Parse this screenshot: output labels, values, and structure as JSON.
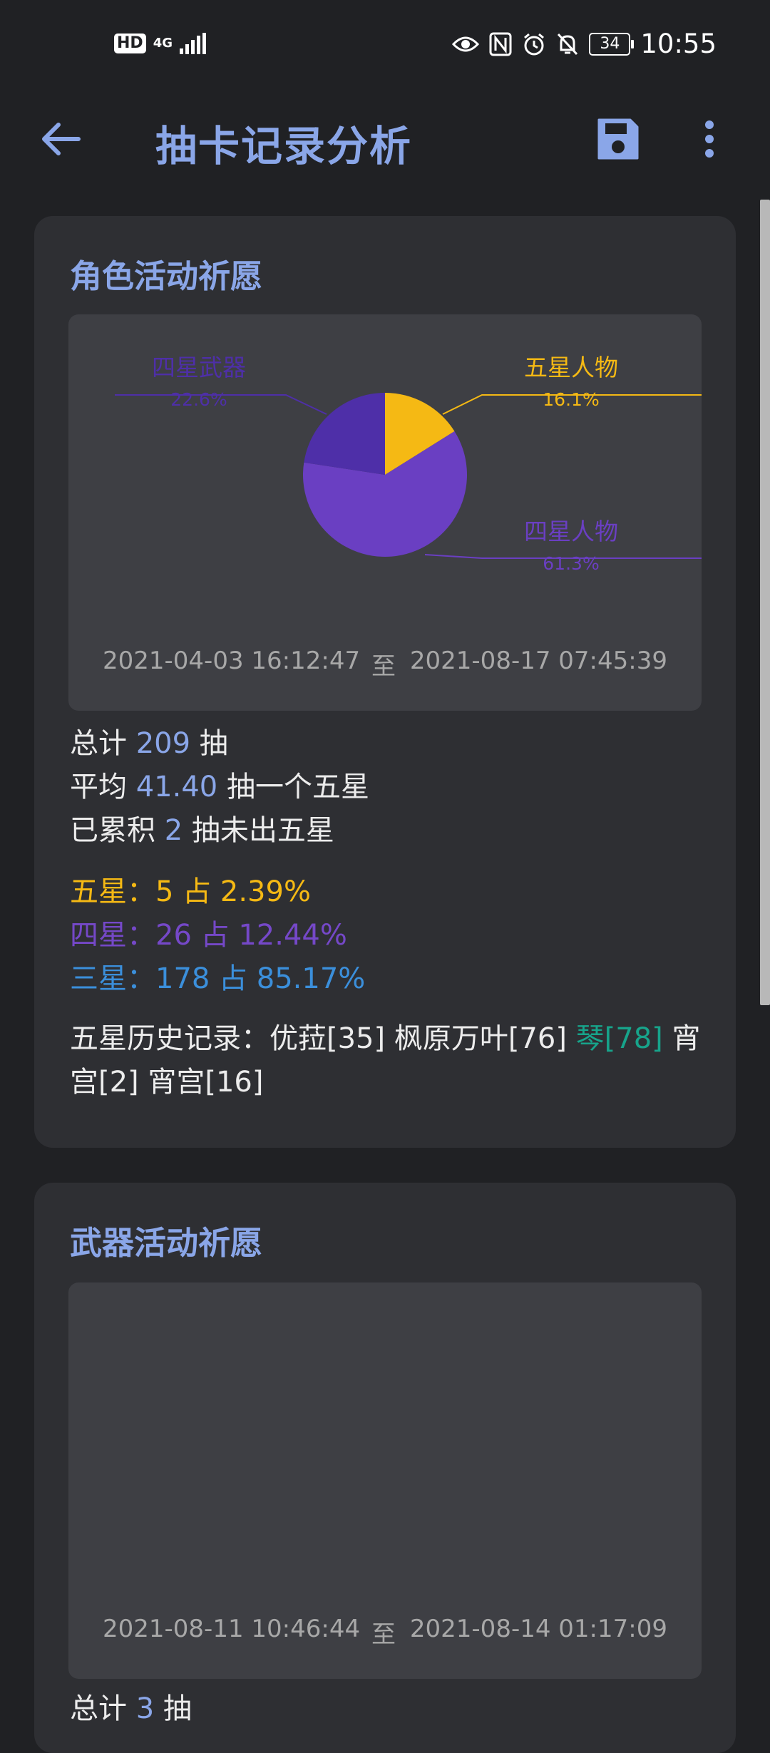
{
  "status_bar": {
    "hd": "HD",
    "network": "4G",
    "battery": "34",
    "time": "10:55"
  },
  "app_bar": {
    "title": "抽卡记录分析"
  },
  "character_banner": {
    "title": "角色活动祈愿",
    "time_start": "2021-04-03 16:12:47",
    "time_sep": "至",
    "time_end": "2021-08-17 07:45:39",
    "total_prefix": "总计 ",
    "total": "209",
    "total_suffix": " 抽",
    "avg_prefix": "平均 ",
    "avg": "41.40",
    "avg_suffix": " 抽一个五星",
    "pity_prefix": "已累积 ",
    "pity": "2",
    "pity_suffix": " 抽未出五星",
    "five_star": "五星：5 占 2.39%",
    "four_star": "四星：26 占 12.44%",
    "three_star": "三星：178 占 85.17%",
    "history_prefix": "五星历史记录：优菈[35] 枫原万叶[76] ",
    "history_highlight": "琴[78]",
    "history_suffix": " 宵宫[2] 宵宫[16]"
  },
  "weapon_banner": {
    "title": "武器活动祈愿",
    "time_start": "2021-08-11 10:46:44",
    "time_sep": "至",
    "time_end": "2021-08-14 01:17:09",
    "total_prefix": "总计 ",
    "total": "3",
    "total_suffix": " 抽"
  },
  "chart_data": {
    "type": "pie",
    "slices": [
      {
        "label": "五星人物",
        "value": 16.1,
        "pct_text": "16.1%",
        "color": "#f5b914"
      },
      {
        "label": "四星人物",
        "value": 61.3,
        "pct_text": "61.3%",
        "color": "#6a3fc2"
      },
      {
        "label": "四星武器",
        "value": 22.6,
        "pct_text": "22.6%",
        "color": "#4e2fa8"
      }
    ]
  },
  "colors": {
    "accent": "#8aa6e8",
    "five_star": "#f5b914",
    "four_star": "#7548c8",
    "three_star": "#3b8fdb",
    "highlight": "#17a48b"
  }
}
